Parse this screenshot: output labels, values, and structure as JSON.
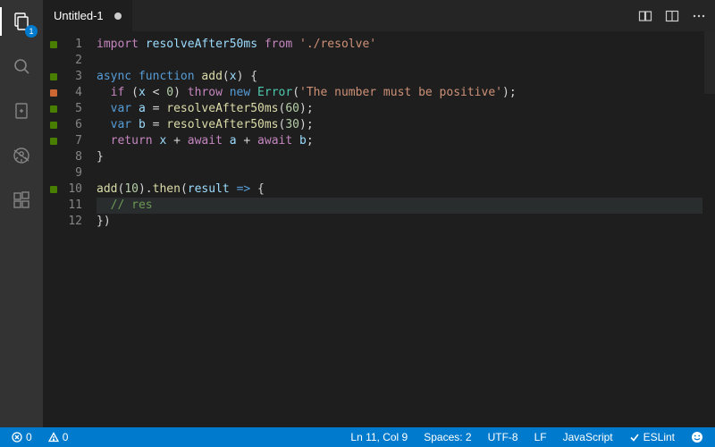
{
  "activity": {
    "explorer_badge": "1"
  },
  "tab": {
    "title": "Untitled-1"
  },
  "gutter": [
    "1",
    "2",
    "3",
    "4",
    "5",
    "6",
    "7",
    "8",
    "9",
    "10",
    "11",
    "12"
  ],
  "markers": {
    "1": "green",
    "3": "green",
    "4": "orange",
    "5": "green",
    "6": "green",
    "7": "green",
    "10": "green"
  },
  "code": {
    "l1": {
      "a": "import",
      "b": "resolveAfter50ms",
      "c": "from",
      "d": "'./resolve'"
    },
    "l3": {
      "a": "async",
      "b": "function",
      "c": "add",
      "d": "x"
    },
    "l4": {
      "a": "if",
      "b": "x",
      "c": "0",
      "d": "throw",
      "e": "new",
      "f": "Error",
      "g": "'The number must be positive'"
    },
    "l5": {
      "a": "var",
      "b": "a",
      "c": "resolveAfter50ms",
      "d": "60"
    },
    "l6": {
      "a": "var",
      "b": "b",
      "c": "resolveAfter50ms",
      "d": "30"
    },
    "l7": {
      "a": "return",
      "b": "x",
      "c": "await",
      "d": "a",
      "e": "await",
      "f": "b"
    },
    "l10": {
      "a": "add",
      "b": "10",
      "c": "then",
      "d": "result"
    },
    "l11": {
      "a": "// res"
    },
    "l12": {
      "a": "})"
    }
  },
  "status": {
    "errors": "0",
    "warnings": "0",
    "cursor": "Ln 11, Col 9",
    "spaces": "Spaces: 2",
    "encoding": "UTF-8",
    "eol": "LF",
    "lang": "JavaScript",
    "eslint": "ESLint"
  }
}
